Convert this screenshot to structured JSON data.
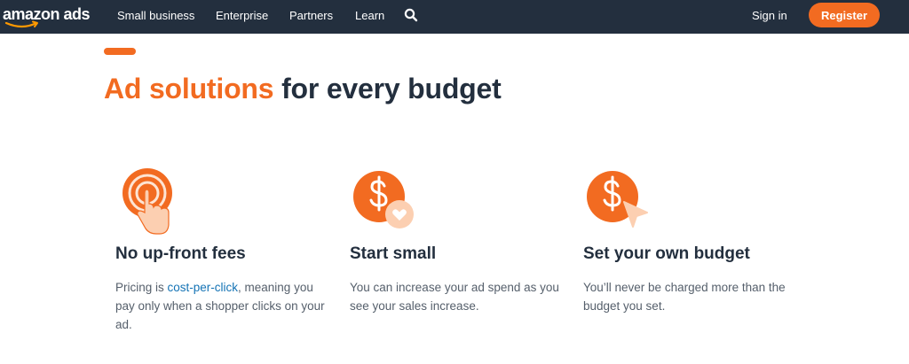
{
  "nav": {
    "logo_text": "amazon ads",
    "links": [
      "Small business",
      "Enterprise",
      "Partners",
      "Learn"
    ],
    "search_icon": "search-icon",
    "signin_label": "Sign in",
    "register_label": "Register"
  },
  "colors": {
    "accent": "#f26b21",
    "nav_bg": "#232f3e",
    "text_dark": "#232f3e",
    "link": "#1473b5"
  },
  "hero": {
    "headline_accent": "Ad solutions",
    "headline_rest": " for every budget"
  },
  "features": [
    {
      "icon": "tap-target-icon",
      "title": "No up-front fees",
      "desc_prefix": "Pricing is ",
      "desc_link": "cost-per-click",
      "desc_suffix": ", meaning you pay only when a shopper clicks on your ad."
    },
    {
      "icon": "dollar-heart-icon",
      "title": "Start small",
      "desc": "You can increase your ad spend as you see your sales increase."
    },
    {
      "icon": "dollar-cursor-icon",
      "title": "Set your own budget",
      "desc": "You’ll never be charged more than the budget you set."
    }
  ]
}
